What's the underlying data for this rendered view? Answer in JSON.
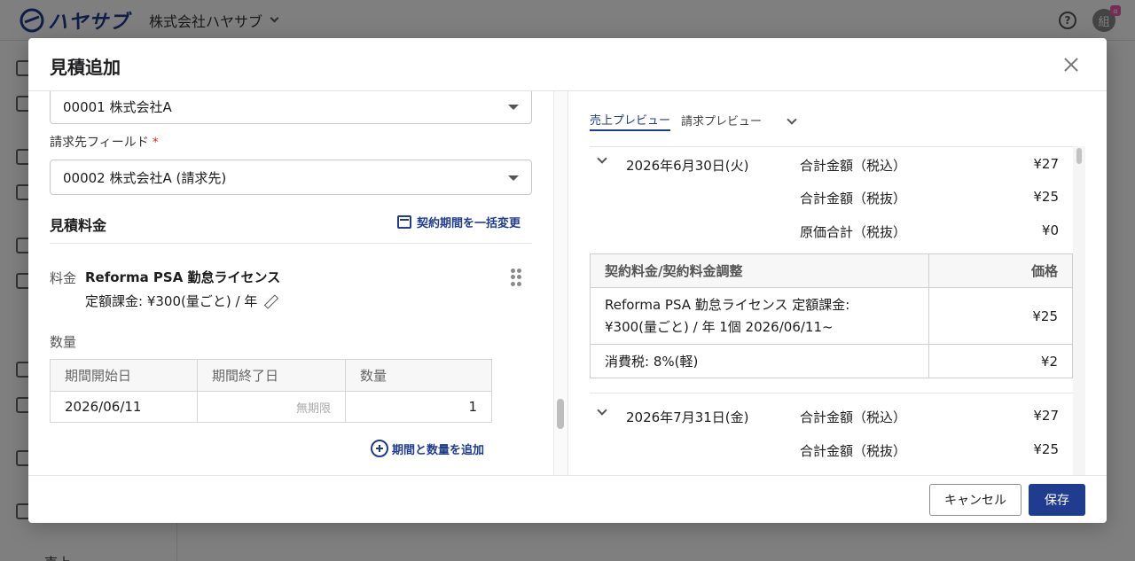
{
  "app": {
    "logo_text": "ハヤサブ",
    "company_name": "株式会社ハヤサブ",
    "avatar_text": "組",
    "avatar_badge": "α",
    "sidebar_bottom_label": "売上"
  },
  "modal": {
    "title": "見積追加",
    "customer_select_value": "00001 株式会社A",
    "billing_field_label": "請求先フィールド",
    "required_mark": "*",
    "billing_select_value": "00002 株式会社A (請求先)",
    "section_title": "見積料金",
    "bulk_change_link": "契約期間を一括変更",
    "fee": {
      "label": "料金",
      "name": "Reforma PSA 勤怠ライセンス",
      "detail": "定額課金: ¥300(量ごと) / 年"
    },
    "quantity": {
      "label": "数量",
      "headers": [
        "期間開始日",
        "期間終了日",
        "数量"
      ],
      "rows": [
        {
          "start": "2026/06/11",
          "end": "無期限",
          "qty": "1"
        }
      ]
    },
    "add_period_link": "期間と数量を追加",
    "preview": {
      "tabs": [
        "売上プレビュー",
        "請求プレビュー"
      ],
      "active_tab": "売上プレビュー",
      "periods": [
        {
          "date": "2026年6月30日(火)",
          "summary": [
            {
              "label": "合計金額（税込）",
              "value": "¥27"
            },
            {
              "label": "合計金額（税抜）",
              "value": "¥25"
            },
            {
              "label": "原価合計（税抜）",
              "value": "¥0"
            }
          ]
        },
        {
          "date": "2026年7月31日(金)",
          "summary": [
            {
              "label": "合計金額（税込）",
              "value": "¥27"
            },
            {
              "label": "合計金額（税抜）",
              "value": "¥25"
            }
          ]
        }
      ],
      "detail_table": {
        "headers": [
          "契約料金/契約料金調整",
          "価格"
        ],
        "rows": [
          {
            "item_line1": "Reforma PSA 勤怠ライセンス 定額課金:",
            "item_line2": "¥300(量ごと) / 年 1個 2026/06/11~",
            "price": "¥25"
          },
          {
            "item_line1": "消費税: 8%(軽)",
            "item_line2": "",
            "price": "¥2"
          }
        ]
      }
    },
    "footer": {
      "cancel_label": "キャンセル",
      "save_label": "保存"
    }
  },
  "colors": {
    "accent": "#1f3c8f",
    "required": "#d32f2f"
  }
}
